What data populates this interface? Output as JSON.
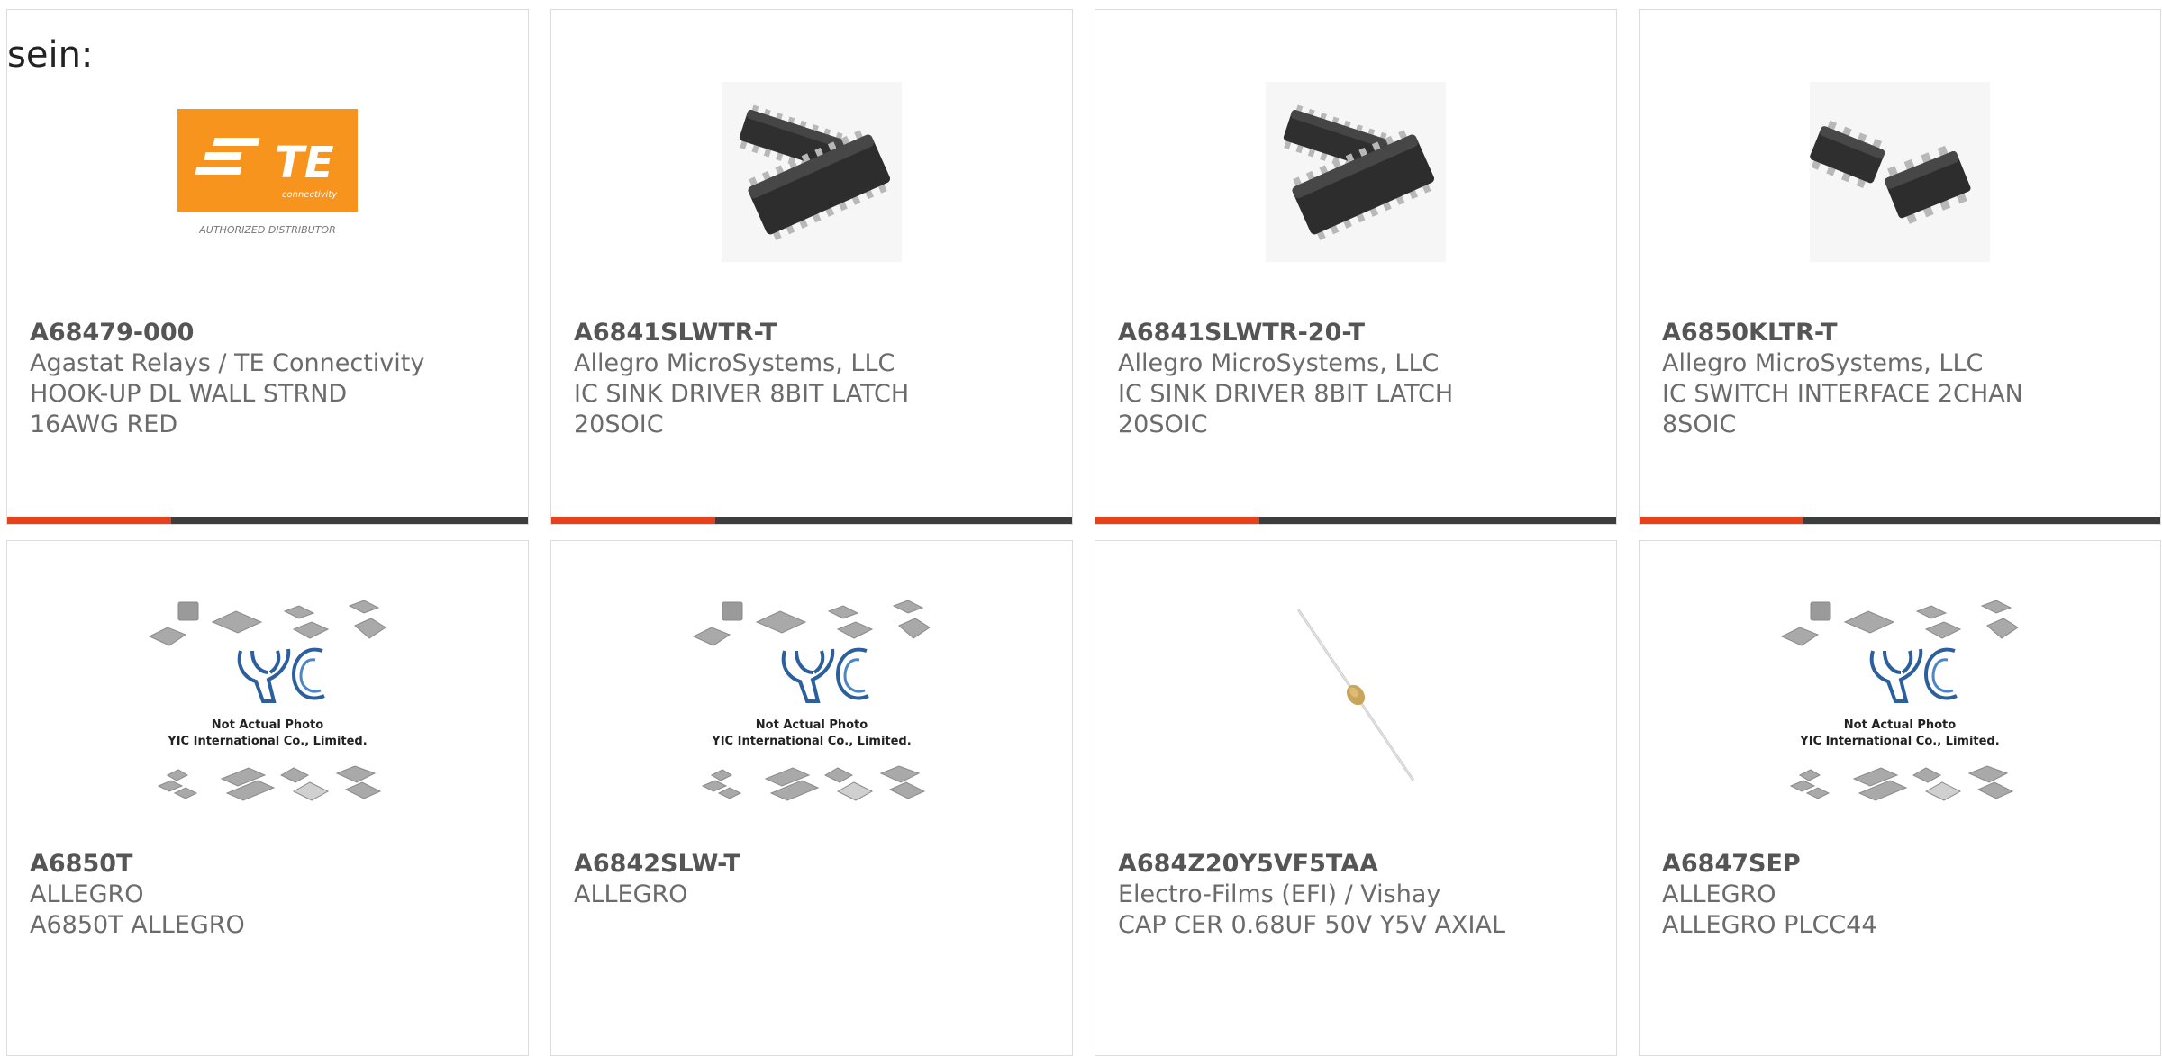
{
  "intro_text": "sein:",
  "colors": {
    "accent": "#e8411d",
    "bar": "#3d3d3d",
    "te_orange": "#f7941d"
  },
  "products": [
    {
      "part": "A68479-000",
      "manufacturer": "Agastat Relays / TE Connectivity",
      "description": "HOOK-UP DL WALL STRND 16AWG RED",
      "image": "te-connectivity-logo",
      "logo_text": "TE",
      "logo_sub": "connectivity",
      "logo_caption": "AUTHORIZED DISTRIBUTOR"
    },
    {
      "part": "A6841SLWTR-T",
      "manufacturer": "Allegro MicroSystems, LLC",
      "description": "IC SINK DRIVER 8BIT LATCH 20SOIC",
      "image": "soic-20-chip"
    },
    {
      "part": "A6841SLWTR-20-T",
      "manufacturer": "Allegro MicroSystems, LLC",
      "description": "IC SINK DRIVER 8BIT LATCH 20SOIC",
      "image": "soic-20-chip"
    },
    {
      "part": "A6850KLTR-T",
      "manufacturer": "Allegro MicroSystems, LLC",
      "description": "IC SWITCH INTERFACE 2CHAN 8SOIC",
      "image": "soic-8-chip"
    },
    {
      "part": "A6850T",
      "manufacturer": "ALLEGRO",
      "description": "A6850T ALLEGRO",
      "image": "yic-placeholder"
    },
    {
      "part": "A6842SLW-T",
      "manufacturer": "ALLEGRO",
      "description": "",
      "image": "yic-placeholder"
    },
    {
      "part": "A684Z20Y5VF5TAA",
      "manufacturer": "Electro-Films (EFI) / Vishay",
      "description": "CAP CER 0.68UF 50V Y5V AXIAL",
      "image": "axial-capacitor"
    },
    {
      "part": "A6847SEP",
      "manufacturer": "ALLEGRO",
      "description": "ALLEGRO PLCC44",
      "image": "yic-placeholder"
    }
  ],
  "placeholder": {
    "brand": "YIC",
    "line1": "Not Actual Photo",
    "line2": "YIC International Co., Limited."
  }
}
